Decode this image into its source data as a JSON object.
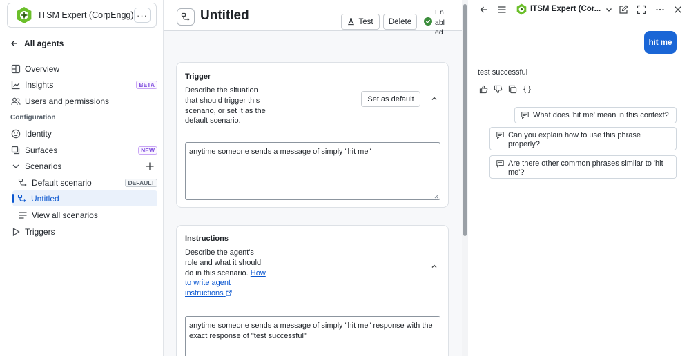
{
  "colors": {
    "accent": "#0b57d0",
    "brand_green": "#6bbf2a",
    "enabled_green": "#3b8d3b",
    "user_bubble": "#1a66d6"
  },
  "sidebar": {
    "agent_name": "ITSM Expert (CorpEngg)",
    "more_label": "···",
    "back_label": "All agents",
    "items": [
      {
        "label": "Overview",
        "icon": "overview-icon"
      },
      {
        "label": "Insights",
        "icon": "chart-icon",
        "badge": "BETA"
      },
      {
        "label": "Users and permissions",
        "icon": "users-icon"
      }
    ],
    "section_label": "Configuration",
    "config_items": [
      {
        "label": "Identity",
        "icon": "smiley-icon"
      },
      {
        "label": "Surfaces",
        "icon": "surfaces-icon",
        "badge": "NEW"
      },
      {
        "label": "Scenarios",
        "icon": "chevron-down-icon"
      },
      {
        "label": "Default scenario",
        "icon": "scenario-icon",
        "badge": "DEFAULT"
      },
      {
        "label": "Untitled",
        "icon": "scenario-icon",
        "active": true
      },
      {
        "label": "View all scenarios",
        "icon": "list-icon"
      },
      {
        "label": "Triggers",
        "icon": "play-icon"
      }
    ]
  },
  "main": {
    "title": "Untitled",
    "test_label": "Test",
    "delete_label": "Delete",
    "enabled_label": "Enabled",
    "trigger": {
      "title": "Trigger",
      "description": "Describe the situation that should trigger this scenario, or set it as the default scenario.",
      "set_default_label": "Set as default",
      "value": "anytime someone sends a message of simply \"hit me\""
    },
    "instructions": {
      "title": "Instructions",
      "description": "Describe the agent's role and what it should do in this scenario. ",
      "link_label": "How to write agent instructions",
      "value": "anytime someone sends a message of simply \"hit me\" response with the exact response of \"test successful\""
    }
  },
  "chat": {
    "title": "ITSM Expert (Cor...",
    "user_message": "hit me",
    "bot_reply": "test successful",
    "suggestions": [
      "What does 'hit me' mean in this context?",
      "Can you explain how to use this phrase properly?",
      "Are there other common phrases similar to 'hit me'?"
    ]
  }
}
